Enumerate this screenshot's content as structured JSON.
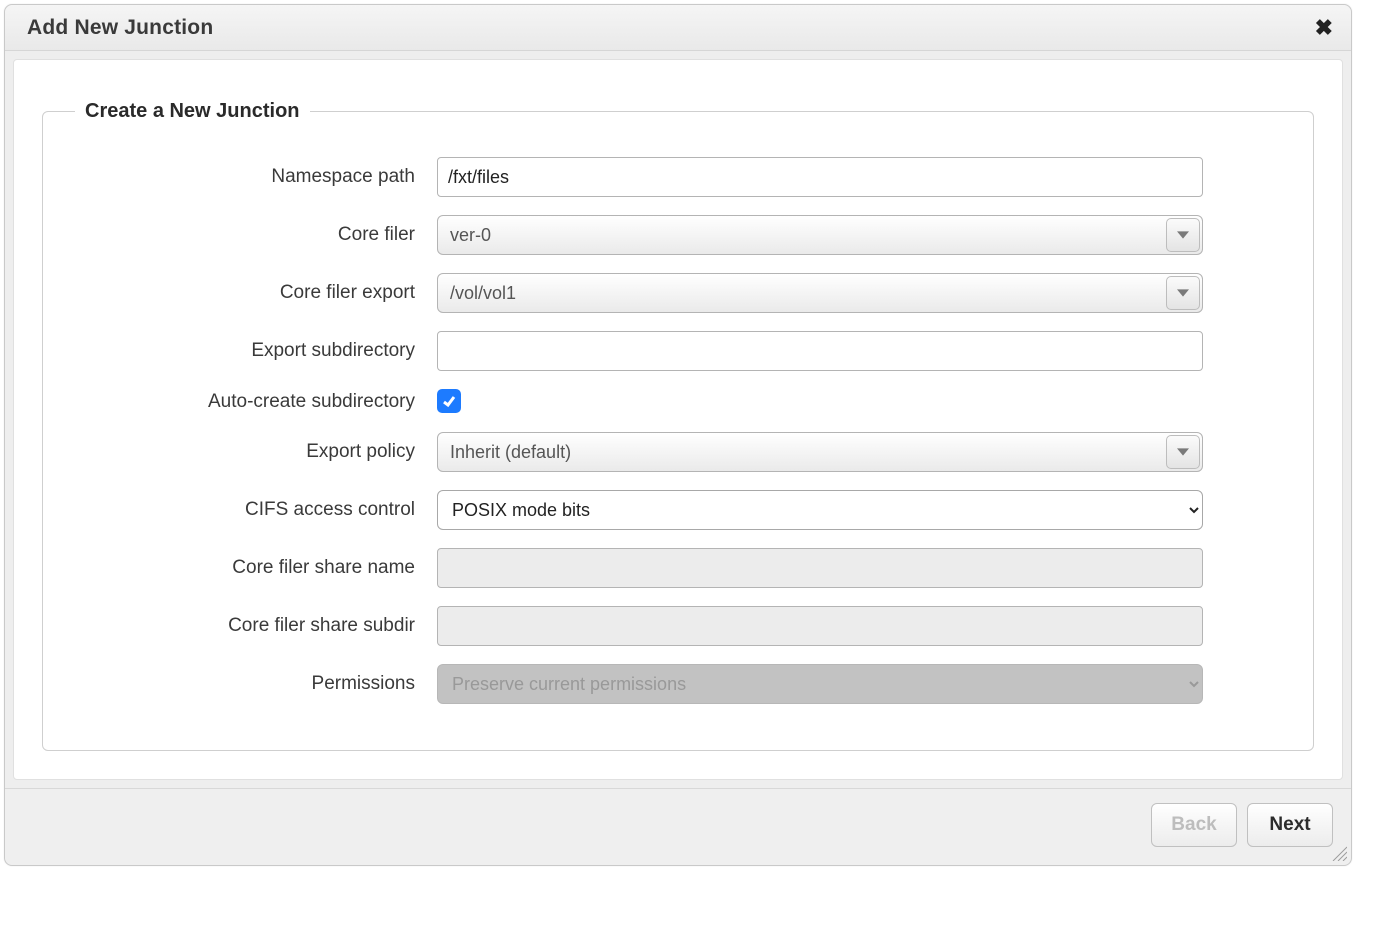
{
  "dialog": {
    "title": "Add New Junction",
    "group_legend": "Create a New Junction"
  },
  "labels": {
    "namespace_path": "Namespace path",
    "core_filer": "Core filer",
    "core_filer_export": "Core filer export",
    "export_subdir": "Export subdirectory",
    "auto_create": "Auto-create subdirectory",
    "export_policy": "Export policy",
    "cifs_access": "CIFS access control",
    "share_name": "Core filer share name",
    "share_subdir": "Core filer share subdir",
    "permissions": "Permissions"
  },
  "values": {
    "namespace_path": "/fxt/files",
    "core_filer": "ver-0",
    "core_filer_export": "/vol/vol1",
    "export_subdir": "",
    "auto_create_checked": true,
    "export_policy": "Inherit (default)",
    "cifs_access": "POSIX mode bits",
    "share_name": "",
    "share_subdir": "",
    "permissions": "Preserve current permissions"
  },
  "buttons": {
    "back": "Back",
    "next": "Next"
  }
}
